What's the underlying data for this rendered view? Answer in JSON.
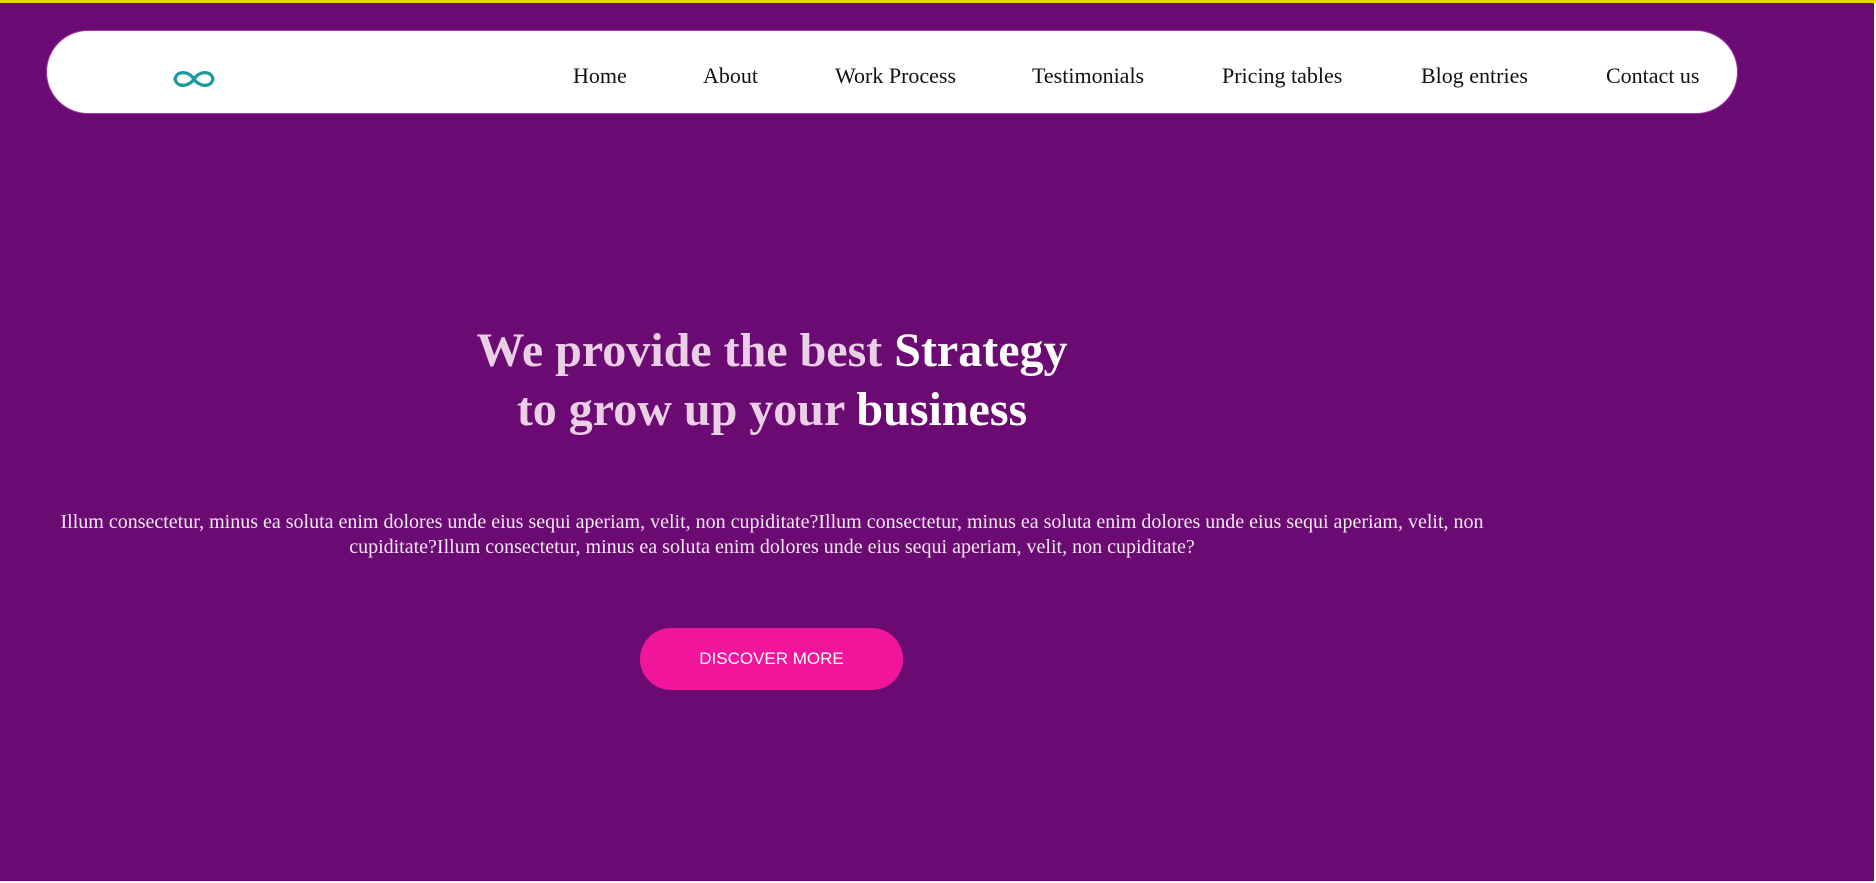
{
  "header": {
    "logo_icon": "infinity-icon",
    "nav": [
      {
        "label": "Home"
      },
      {
        "label": "About"
      },
      {
        "label": "Work Process"
      },
      {
        "label": "Testimonials"
      },
      {
        "label": "Pricing tables"
      },
      {
        "label": "Blog entries"
      },
      {
        "label": "Contact us"
      }
    ]
  },
  "hero": {
    "headline": {
      "line1_part1": "We provide the best ",
      "line1_highlight": "Strategy",
      "line2_part1": "to grow up your ",
      "line2_highlight": "business"
    },
    "description": "Illum consectetur, minus ea soluta enim dolores unde eius sequi aperiam, velit, non cupiditate?Illum consectetur, minus ea soluta enim dolores unde eius sequi aperiam, velit, non cupiditate?Illum consectetur, minus ea soluta enim dolores unde eius sequi aperiam, velit, non cupiditate?",
    "cta_label": "DISCOVER MORE"
  },
  "colors": {
    "hero_background": "#6b0a72",
    "cta_background": "#f0159a",
    "top_accent_line": "#e6d800",
    "logo": "#1a9aa0"
  }
}
